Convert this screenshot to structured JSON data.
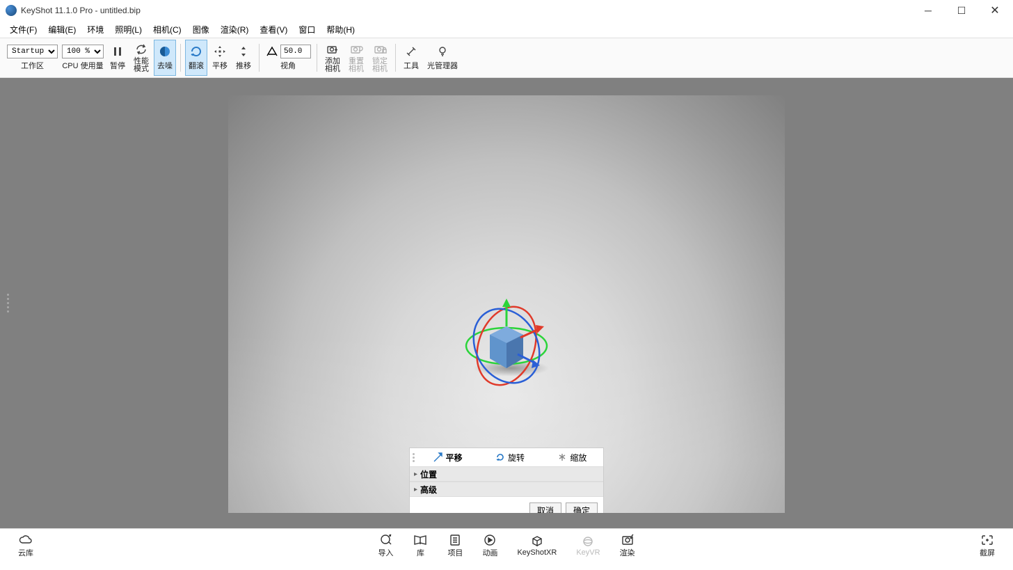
{
  "title": "KeyShot 11.1.0 Pro  - untitled.bip",
  "menu": [
    "文件(F)",
    "编辑(E)",
    "环境",
    "照明(L)",
    "相机(C)",
    "图像",
    "渲染(R)",
    "查看(V)",
    "窗口",
    "帮助(H)"
  ],
  "toolbar": {
    "workspace_select": "Startup",
    "workspace_label": "工作区",
    "zoom_select": "100 %",
    "cpu_label": "CPU 使用量",
    "pause": "暂停",
    "perf_mode1": "性能",
    "perf_mode2": "模式",
    "denoise": "去噪",
    "tumble": "翻滚",
    "pan": "平移",
    "dolly": "推移",
    "fov_value": "50.0",
    "fov_label": "视角",
    "add_camera1": "添加",
    "add_camera2": "相机",
    "reset_camera1": "重置",
    "reset_camera2": "相机",
    "lock_camera1": "锁定",
    "lock_camera2": "相机",
    "tools": "工具",
    "light_manager": "光管理器"
  },
  "gizmo": {
    "tabs": {
      "translate": "平移",
      "rotate": "旋转",
      "scale": "缩放"
    },
    "sections": {
      "position": "位置",
      "advanced": "高级"
    },
    "cancel": "取消",
    "ok": "确定"
  },
  "bottom": {
    "cloud": "云库",
    "import": "导入",
    "library": "库",
    "project": "项目",
    "animation": "动画",
    "keyshotxr": "KeyShotXR",
    "keyvr": "KeyVR",
    "render": "渲染",
    "screenshot": "截屏"
  },
  "footer_text": ""
}
